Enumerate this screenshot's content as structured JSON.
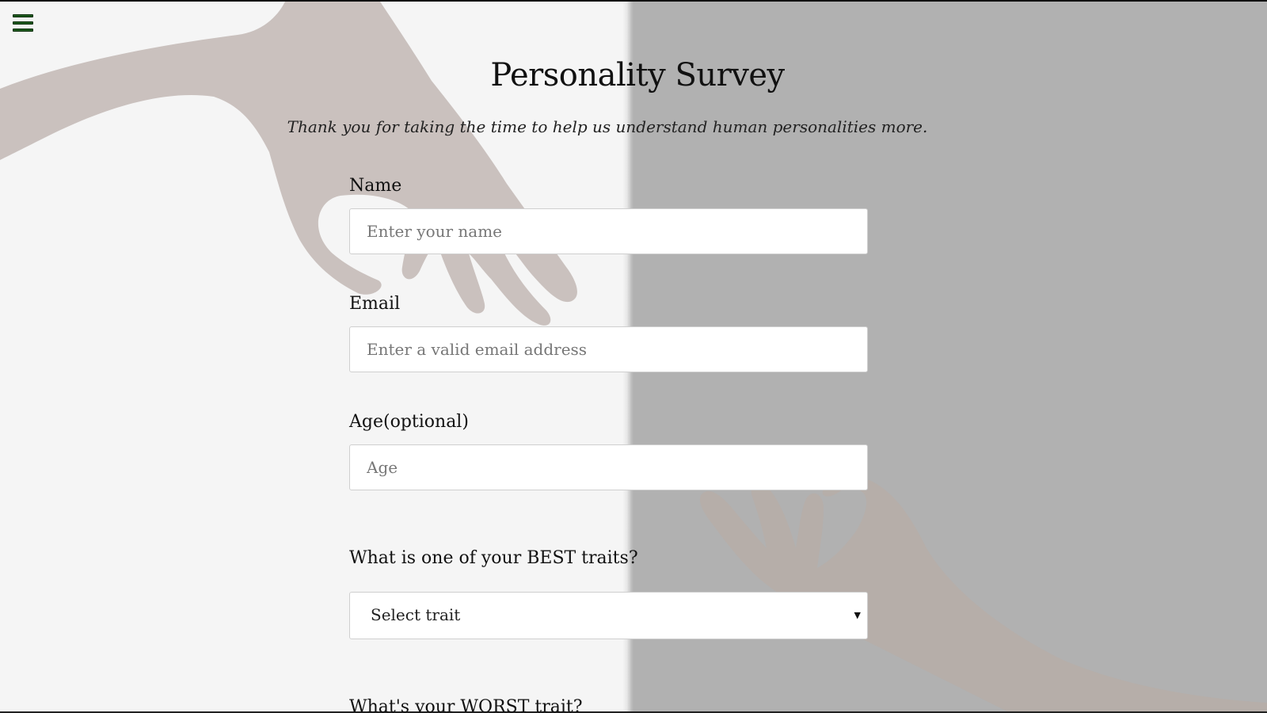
{
  "menu": {
    "icon": "hamburger-menu-icon"
  },
  "header": {
    "title": "Personality Survey",
    "subtitle": "Thank you for taking the time to help us understand human personalities more."
  },
  "form": {
    "name": {
      "label": "Name",
      "placeholder": "Enter your name"
    },
    "email": {
      "label": "Email",
      "placeholder": "Enter a valid email address"
    },
    "age": {
      "label": "Age(optional)",
      "placeholder": "Age"
    },
    "best_trait": {
      "label": "What is one of your BEST traits?",
      "selected": "Select trait"
    },
    "worst_trait": {
      "label": "What's your WORST trait?"
    }
  },
  "colors": {
    "left_background": "#f5f5f5",
    "right_background": "#b1b1b1",
    "menu_accent": "#1e5a1e"
  }
}
